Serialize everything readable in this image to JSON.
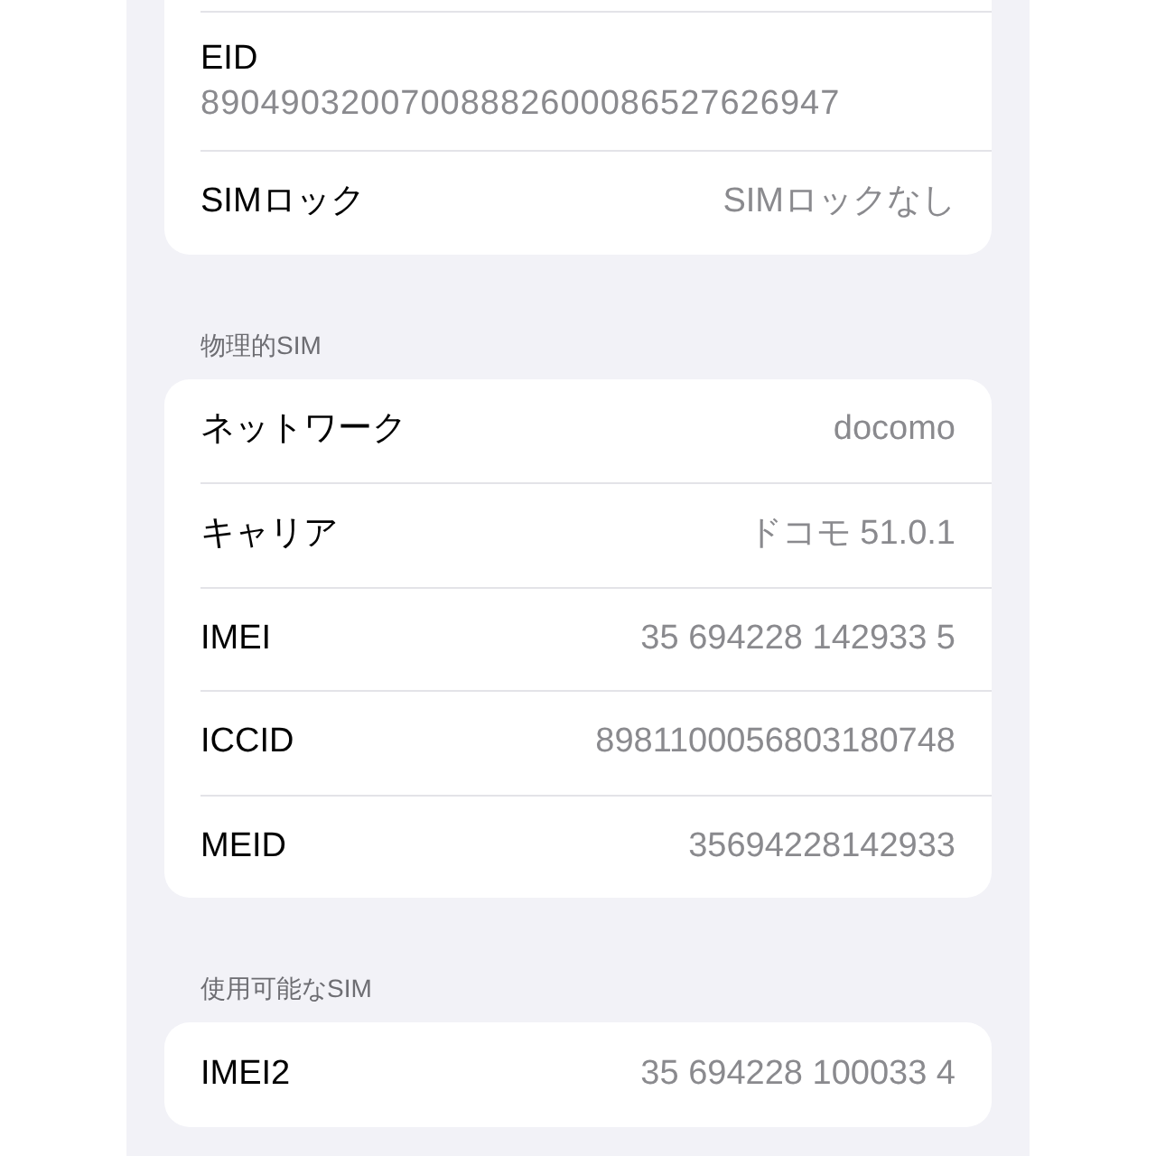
{
  "sections": [
    {
      "rows": [
        {
          "kind": "stacked",
          "label": "EID",
          "value": "89049032007008882600086527626947"
        },
        {
          "kind": "inline",
          "label": "SIMロック",
          "value": "SIMロックなし"
        }
      ]
    },
    {
      "header": "物理的SIM",
      "rows": [
        {
          "kind": "inline",
          "label": "ネットワーク",
          "value": "docomo"
        },
        {
          "kind": "inline",
          "label": "キャリア",
          "value": "ドコモ 51.0.1"
        },
        {
          "kind": "inline",
          "label": "IMEI",
          "value": "35 694228 142933 5"
        },
        {
          "kind": "inline",
          "label": "ICCID",
          "value": "8981100056803180748"
        },
        {
          "kind": "inline",
          "label": "MEID",
          "value": "35694228142933"
        }
      ]
    },
    {
      "header": "使用可能なSIM",
      "rows": [
        {
          "kind": "inline",
          "label": "IMEI2",
          "value": "35 694228 100033 4"
        }
      ]
    }
  ]
}
